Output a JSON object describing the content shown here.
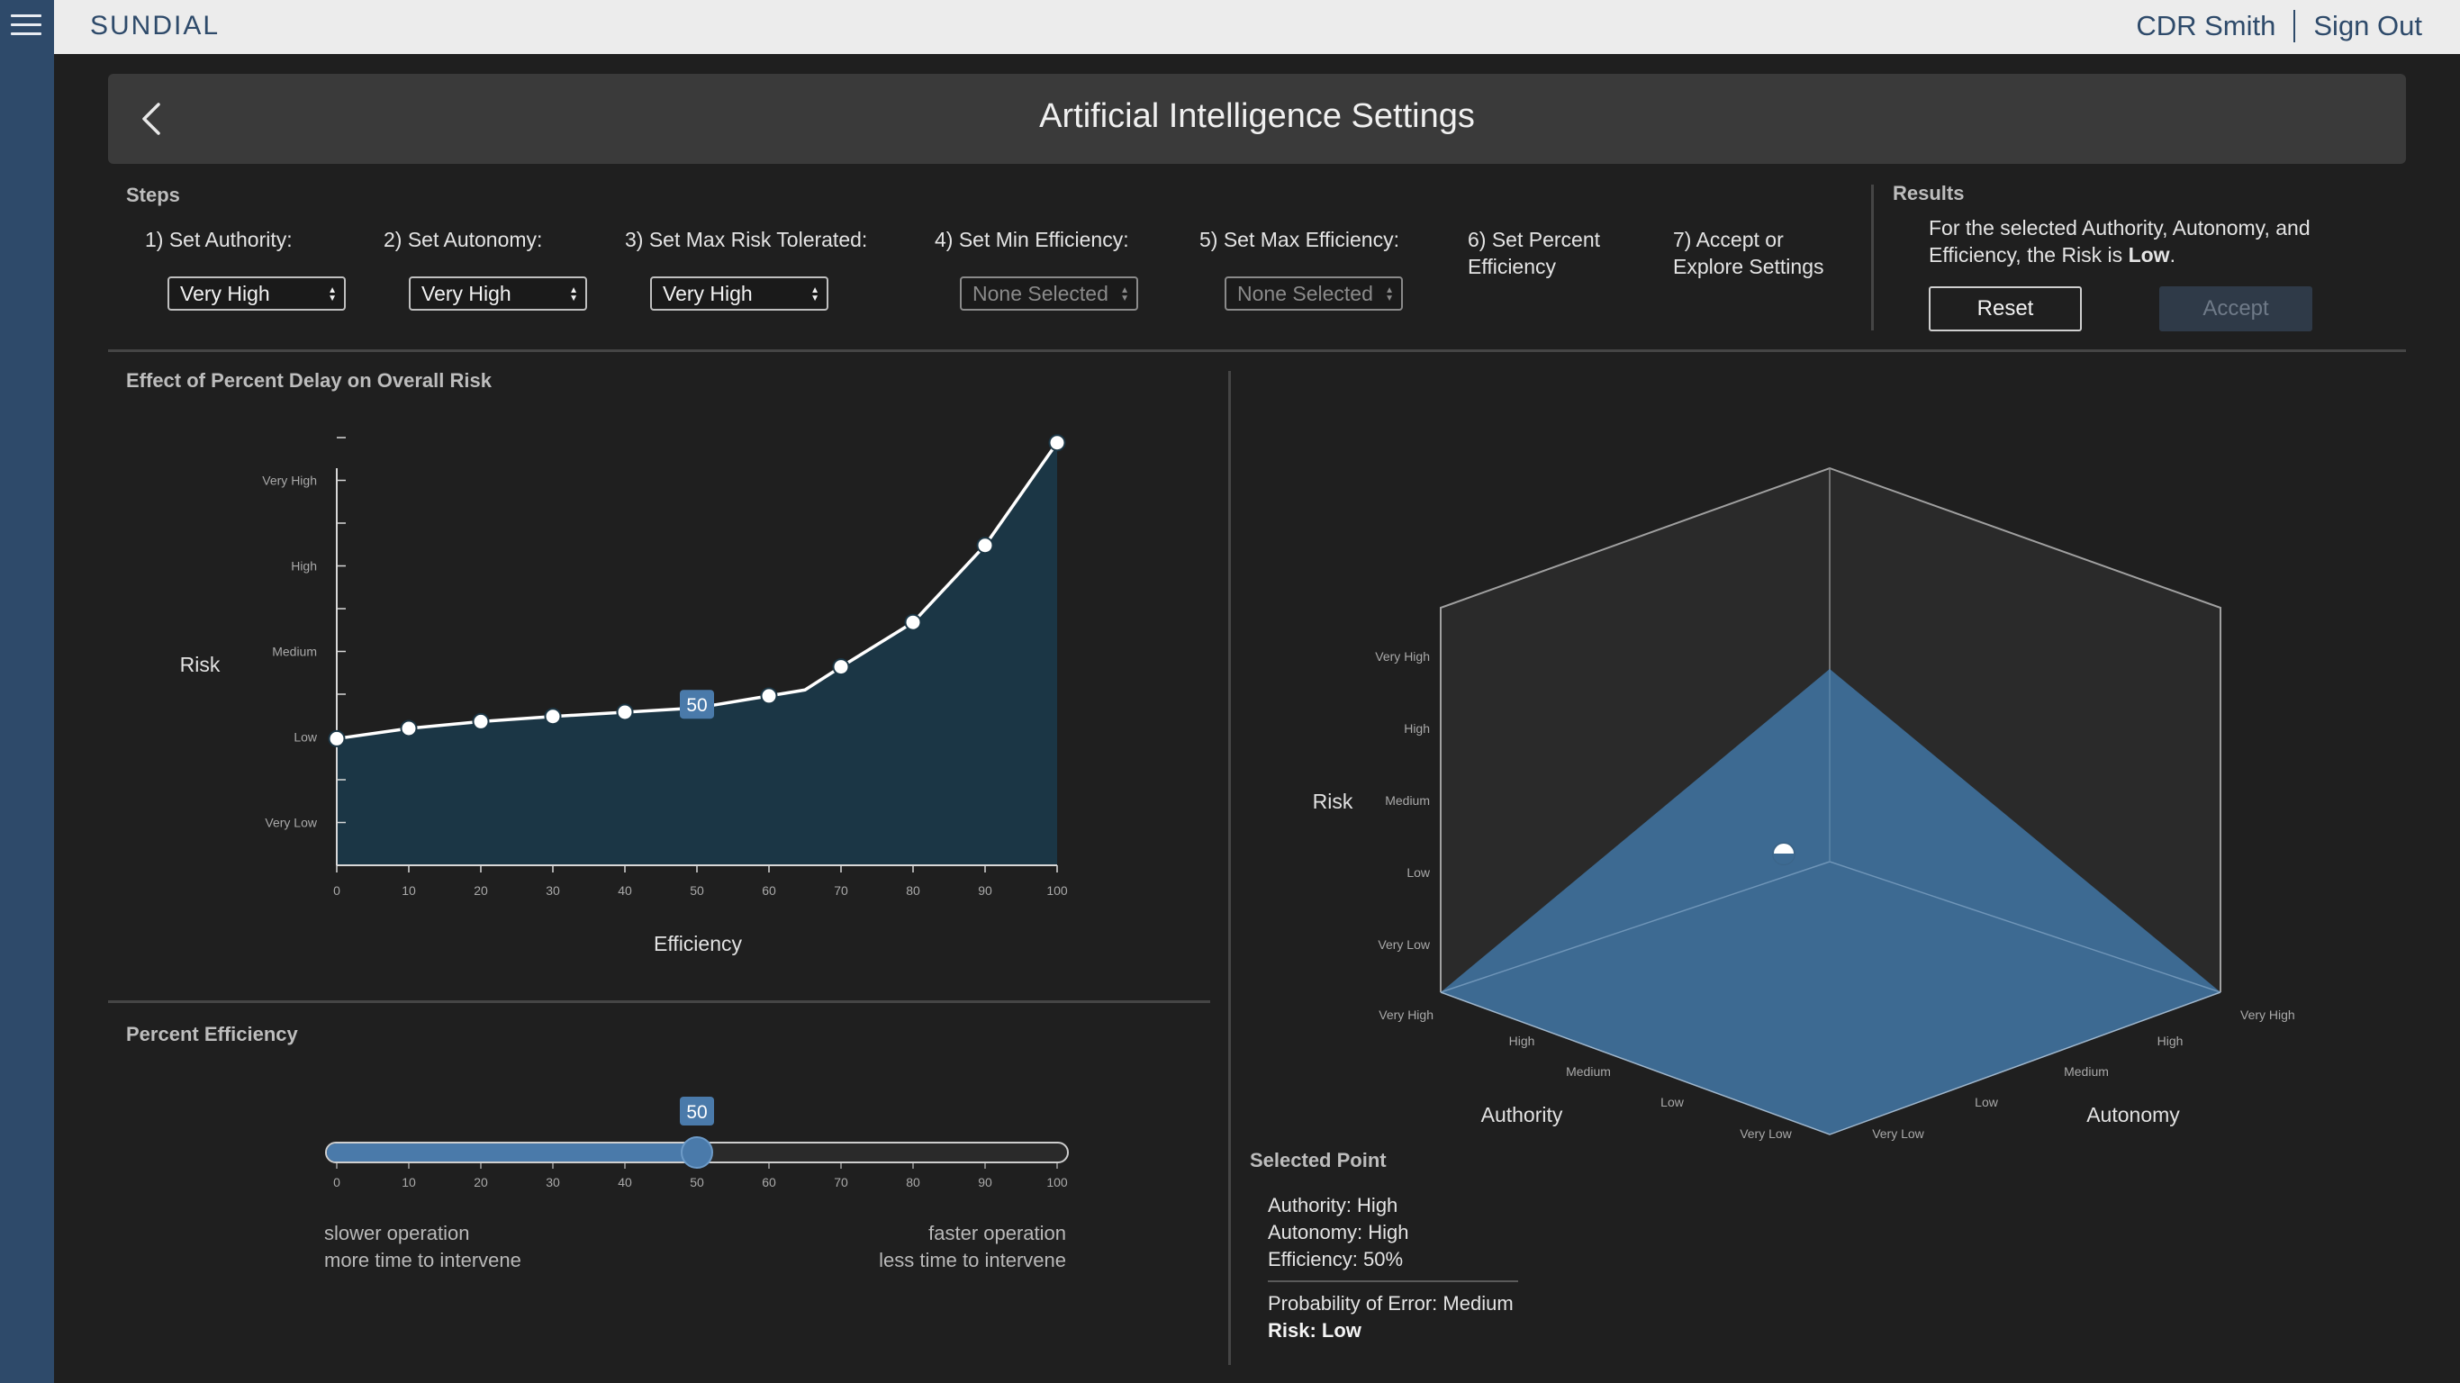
{
  "app": {
    "brand": "SUNDIAL",
    "user": "CDR Smith",
    "sign_out": "Sign Out"
  },
  "icons": {
    "menu": "hamburger-menu-icon",
    "back": "chevron-left-icon"
  },
  "colors": {
    "rail": "#2e4a6a",
    "accent": "#4a7aaa",
    "area_fill": "#1b3645",
    "surface_fill": "#3b6488"
  },
  "page": {
    "title": "Artificial Intelligence Settings"
  },
  "steps": {
    "section_label": "Steps",
    "items": [
      {
        "label": "1) Set Authority:",
        "value": "Very High"
      },
      {
        "label": "2) Set Autonomy:",
        "value": "Very High"
      },
      {
        "label": "3) Set Max Risk Tolerated:",
        "value": "Very High"
      },
      {
        "label": "4) Set Min Efficiency:",
        "value": "None Selected"
      },
      {
        "label": "5) Set Max Efficiency:",
        "value": "None Selected"
      },
      {
        "label": "6) Set Percent Efficiency"
      },
      {
        "label": "7) Accept or Explore Settings"
      }
    ]
  },
  "results": {
    "label": "Results",
    "text_prefix": "For the selected Authority, Autonomy, and Efficiency, the Risk is",
    "risk_value": "Low",
    "text_suffix": ".",
    "reset": "Reset",
    "accept": "Accept"
  },
  "risk_chart": {
    "title": "Effect of Percent Delay on Overall Risk",
    "selected_label": "50"
  },
  "slider": {
    "title": "Percent Efficiency",
    "value": 50,
    "value_label": "50",
    "ticks": [
      "0",
      "10",
      "20",
      "30",
      "40",
      "50",
      "60",
      "70",
      "80",
      "90",
      "100"
    ],
    "left_caption_1": "slower operation",
    "left_caption_2": "more time to intervene",
    "right_caption_1": "faster operation",
    "right_caption_2": "less time to intervene"
  },
  "surface_chart": {
    "risk_axis_label": "Risk",
    "risk_levels": [
      "Very High",
      "High",
      "Medium",
      "Low",
      "Very Low"
    ],
    "authority_axis_label": "Authority",
    "authority_levels": [
      "Very High",
      "High",
      "Medium",
      "Low",
      "Very Low"
    ],
    "autonomy_axis_label": "Autonomy",
    "autonomy_levels": [
      "Very Low",
      "Low",
      "Medium",
      "High",
      "Very High"
    ]
  },
  "selected_point": {
    "title": "Selected Point",
    "authority": "Authority: High",
    "autonomy": "Autonomy: High",
    "efficiency": "Efficiency: 50%",
    "probability": "Probability of Error: Medium",
    "risk": "Risk: Low"
  },
  "chart_data": {
    "type": "area",
    "title": "Effect of Percent Delay on Overall Risk",
    "xlabel": "Efficiency",
    "ylabel": "Risk",
    "x_ticks": [
      "0",
      "10",
      "20",
      "30",
      "40",
      "50",
      "60",
      "70",
      "80",
      "90",
      "100"
    ],
    "y_categories": [
      "Very Low",
      "Low",
      "Medium",
      "High",
      "Very High"
    ],
    "xlim": [
      0,
      100
    ],
    "ylim": [
      0,
      5
    ],
    "series": [
      {
        "values_x": [
          0,
          10,
          20,
          30,
          40,
          50,
          60,
          65,
          70,
          80,
          90,
          100
        ],
        "values_y": [
          1.48,
          1.6,
          1.68,
          1.74,
          1.79,
          1.84,
          1.98,
          2.05,
          2.32,
          2.84,
          3.74,
          4.94
        ],
        "markers_x": [
          0,
          10,
          20,
          30,
          40,
          60,
          70,
          80,
          90,
          100
        ]
      }
    ],
    "selected_x": 50,
    "grid": false
  }
}
